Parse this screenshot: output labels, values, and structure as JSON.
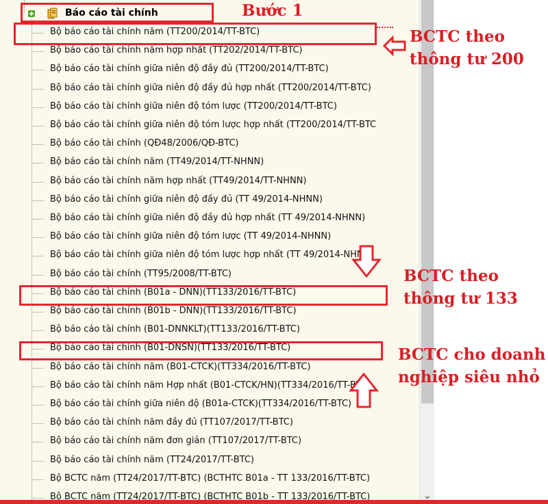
{
  "tree": {
    "root_label": "Báo cáo tài chính",
    "items": [
      "Bộ báo cáo tài chính năm (TT200/2014/TT-BTC)",
      "Bộ báo cáo tài chính năm hợp nhất (TT202/2014/TT-BTC)",
      "Bộ báo cáo tài chính giữa niên độ đầy đủ (TT200/2014/TT-BTC)",
      "Bộ báo cáo tài chính giữa niên độ đầy đủ hợp nhất (TT200/2014/TT-BTC)",
      "Bộ báo cáo tài chính giữa niên độ tóm lược (TT200/2014/TT-BTC)",
      "Bộ báo cáo tài chính giữa niên độ tóm lược hợp nhất (TT200/2014/TT-BTC",
      "Bộ báo cáo tài chính (QĐ48/2006/QĐ-BTC)",
      "Bộ báo cáo tài chính năm (TT49/2014/TT-NHNN)",
      "Bộ báo cáo tài chính năm hợp nhất (TT49/2014/TT-NHNN)",
      "Bộ báo cáo tài chính giữa niên độ đầy đủ (TT 49/2014-NHNN)",
      "Bộ báo cáo tài chính giữa niên độ đầy đủ hợp nhất (TT 49/2014-NHNN)",
      "Bộ báo cáo tài chính giữa niên độ tóm lược (TT 49/2014-NHNN)",
      "Bộ báo cáo tài chính giữa niên độ tóm lược hợp nhất (TT 49/2014-NHNN)",
      "Bộ báo cáo tài chính (TT95/2008/TT-BTC)",
      "Bộ báo cáo tài chính (B01a - DNN)(TT133/2016/TT-BTC)",
      "Bộ báo cáo tài chính (B01b - DNN)(TT133/2016/TT-BTC)",
      "Bộ báo cáo tài chính (B01-DNNKLT)(TT133/2016/TT-BTC)",
      "Bộ báo cáo tài chính (B01-DNSN)(TT133/2016/TT-BTC)",
      "Bộ báo cáo tài chính năm (B01-CTCK)(TT334/2016/TT-BTC)",
      "Bộ báo cáo tài chính năm Hợp nhất (B01-CTCK/HN)(TT334/2016/TT-BTC)",
      "Bộ báo cáo tài chính giữa niên độ (B01a-CTCK)(TT334/2016/TT-BTC)",
      "Bộ báo cáo tài chính năm đầy đủ (TT107/2017/TT-BTC)",
      "Bộ báo cáo tài chính năm đơn giản (TT107/2017/TT-BTC)",
      "Bộ báo cáo tài chính năm (TT24/2017/TT-BTC)",
      "Bộ BCTC năm (TT24/2017/TT-BTC) (BCTHTC B01a - TT 133/2016/TT-BTC)",
      "Bộ BCTC năm (TT24/2017/TT-BTC) (BCTHTC B01b - TT 133/2016/TT-BTC)"
    ]
  },
  "annotations": {
    "step1": "Bước 1",
    "tt200_line1": "BCTC theo",
    "tt200_line2": "thông tư 200",
    "tt133_line1": "BCTC theo",
    "tt133_line2": "thông tư 133",
    "micro_line1": "BCTC cho doanh",
    "micro_line2": "nghiệp siêu nhỏ"
  },
  "icons": {
    "expand": "minus-expand-icon",
    "folder": "book-folder-icon",
    "scroll_down": "scroll-down-arrow-icon"
  },
  "colors": {
    "highlight_red": "#e4262c",
    "annotation_red": "#d81f26",
    "panel_bg": "#fbf8ec",
    "expand_green": "#5aa02c"
  }
}
